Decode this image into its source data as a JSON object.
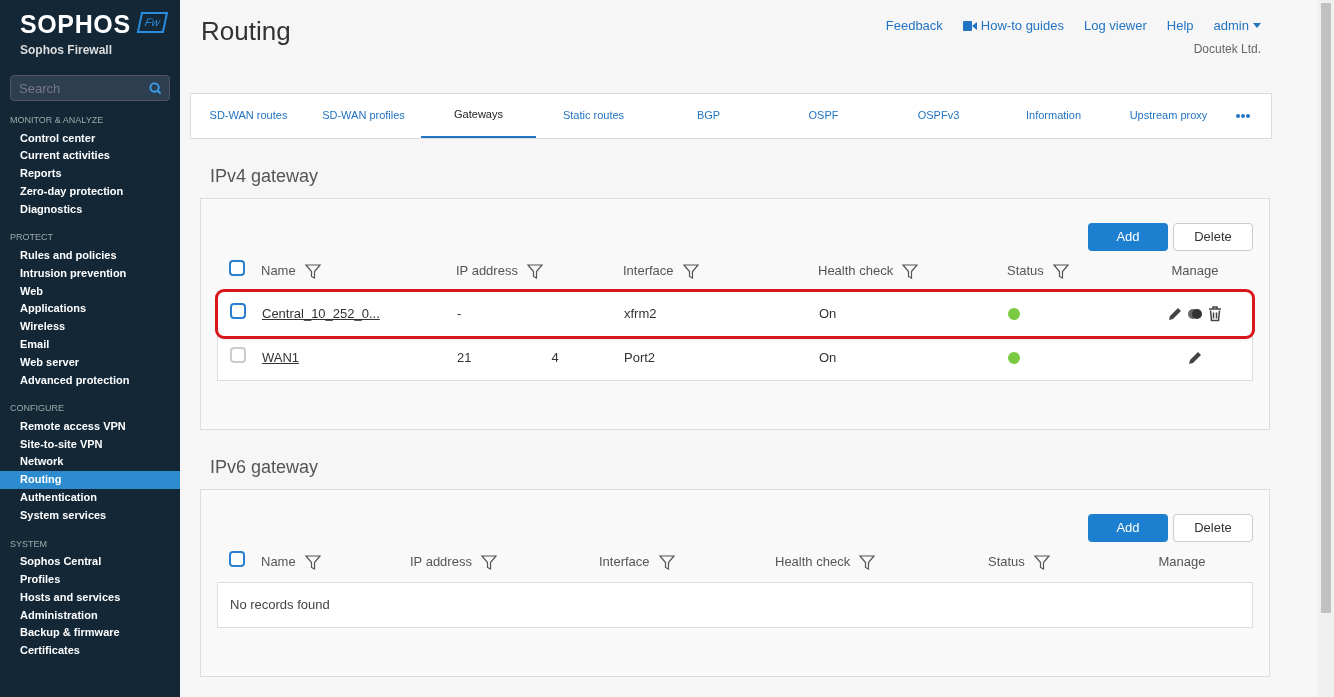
{
  "sidebar": {
    "brand": "SOPHOS",
    "badge": "Fw",
    "product": "Sophos Firewall",
    "search": {
      "placeholder": "Search"
    },
    "sections": [
      {
        "heading": "MONITOR & ANALYZE",
        "items": [
          {
            "label": "Control center",
            "selected": false
          },
          {
            "label": "Current activities",
            "selected": false
          },
          {
            "label": "Reports",
            "selected": false
          },
          {
            "label": "Zero-day protection",
            "selected": false
          },
          {
            "label": "Diagnostics",
            "selected": false
          }
        ]
      },
      {
        "heading": "PROTECT",
        "items": [
          {
            "label": "Rules and policies",
            "selected": false
          },
          {
            "label": "Intrusion prevention",
            "selected": false
          },
          {
            "label": "Web",
            "selected": false
          },
          {
            "label": "Applications",
            "selected": false
          },
          {
            "label": "Wireless",
            "selected": false
          },
          {
            "label": "Email",
            "selected": false
          },
          {
            "label": "Web server",
            "selected": false
          },
          {
            "label": "Advanced protection",
            "selected": false
          }
        ]
      },
      {
        "heading": "CONFIGURE",
        "items": [
          {
            "label": "Remote access VPN",
            "selected": false
          },
          {
            "label": "Site-to-site VPN",
            "selected": false
          },
          {
            "label": "Network",
            "selected": false
          },
          {
            "label": "Routing",
            "selected": true
          },
          {
            "label": "Authentication",
            "selected": false
          },
          {
            "label": "System services",
            "selected": false
          }
        ]
      },
      {
        "heading": "SYSTEM",
        "items": [
          {
            "label": "Sophos Central",
            "selected": false
          },
          {
            "label": "Profiles",
            "selected": false
          },
          {
            "label": "Hosts and services",
            "selected": false
          },
          {
            "label": "Administration",
            "selected": false
          },
          {
            "label": "Backup & firmware",
            "selected": false
          },
          {
            "label": "Certificates",
            "selected": false
          }
        ]
      }
    ]
  },
  "page": {
    "title": "Routing",
    "links": [
      "Feedback",
      "How-to guides",
      "Log viewer",
      "Help"
    ],
    "user": "admin",
    "company": "Docutek Ltd."
  },
  "tabs": [
    {
      "label": "SD-WAN routes",
      "selected": false
    },
    {
      "label": "SD-WAN profiles",
      "selected": false
    },
    {
      "label": "Gateways",
      "selected": true
    },
    {
      "label": "Static routes",
      "selected": false
    },
    {
      "label": "BGP",
      "selected": false
    },
    {
      "label": "OSPF",
      "selected": false
    },
    {
      "label": "OSPFv3",
      "selected": false
    },
    {
      "label": "Information",
      "selected": false
    },
    {
      "label": "Upstream proxy",
      "selected": false
    }
  ],
  "ipv4": {
    "title": "IPv4 gateway",
    "buttons": [
      "Add",
      "Delete"
    ],
    "columns": [
      "Name",
      "IP address",
      "Interface",
      "Health check",
      "Status",
      "Manage"
    ],
    "all_checked": false,
    "rows": [
      {
        "name": "Central_10_252_0...",
        "ip": [
          "-"
        ],
        "interface": "xfrm2",
        "health": "On",
        "color": "#7ac943",
        "highlighted": true,
        "checked": false,
        "checkbox_disabled": false,
        "actions": [
          {
            "kind": "edit"
          },
          {
            "kind": "toggle"
          },
          {
            "kind": "delete"
          }
        ]
      },
      {
        "name": "WAN1",
        "ip": [
          "21",
          "4"
        ],
        "interface": "Port2",
        "health": "On",
        "color": "#7ac943",
        "highlighted": false,
        "checked": false,
        "checkbox_disabled": true,
        "actions": [
          {
            "kind": "edit"
          }
        ]
      }
    ]
  },
  "ipv6": {
    "title": "IPv6 gateway",
    "buttons": [
      "Add",
      "Delete"
    ],
    "columns": [
      "Name",
      "IP address",
      "Interface",
      "Health check",
      "Status",
      "Manage"
    ],
    "all_checked": false,
    "empty": "No records found"
  }
}
